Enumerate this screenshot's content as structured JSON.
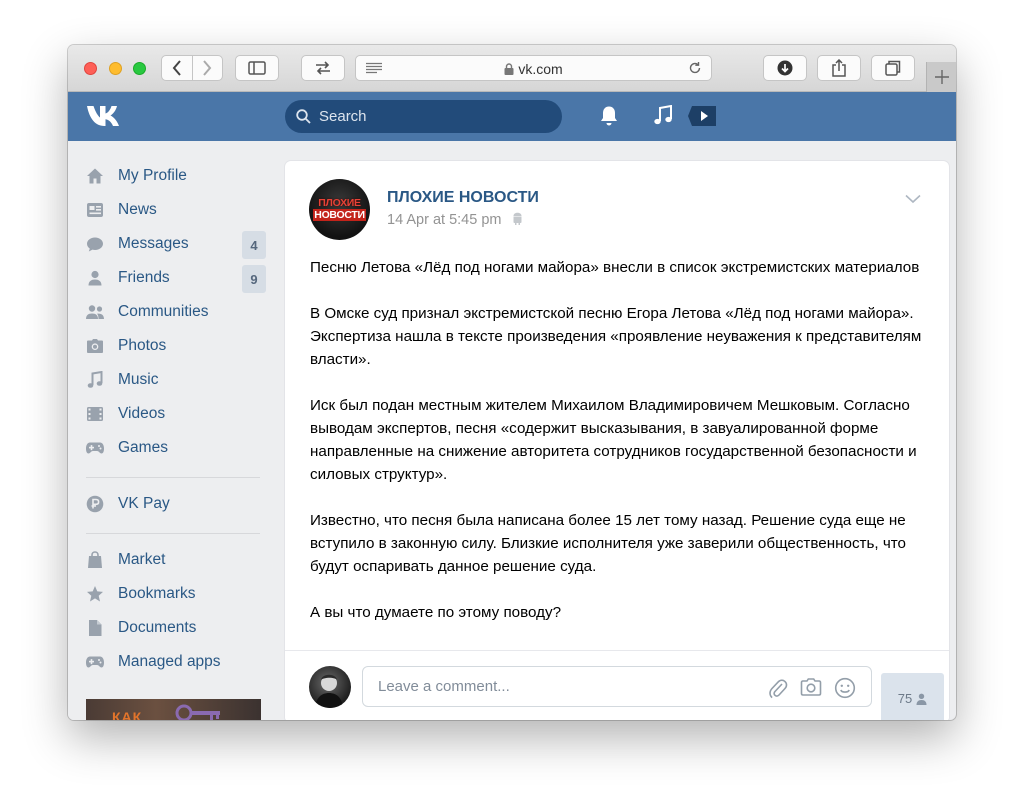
{
  "browser": {
    "url": "vk.com"
  },
  "header": {
    "search_placeholder": "Search"
  },
  "sidebar": {
    "items": [
      {
        "label": "My Profile",
        "icon": "home-icon"
      },
      {
        "label": "News",
        "icon": "newsfeed-icon"
      },
      {
        "label": "Messages",
        "icon": "messages-icon",
        "badge": "4"
      },
      {
        "label": "Friends",
        "icon": "friends-icon",
        "badge": "9"
      },
      {
        "label": "Communities",
        "icon": "communities-icon"
      },
      {
        "label": "Photos",
        "icon": "camera-icon"
      },
      {
        "label": "Music",
        "icon": "music-icon"
      },
      {
        "label": "Videos",
        "icon": "film-icon"
      },
      {
        "label": "Games",
        "icon": "gamepad-icon"
      },
      {
        "label": "VK Pay",
        "icon": "vkpay-icon"
      },
      {
        "label": "Market",
        "icon": "bag-icon"
      },
      {
        "label": "Bookmarks",
        "icon": "star-icon"
      },
      {
        "label": "Documents",
        "icon": "document-icon"
      },
      {
        "label": "Managed apps",
        "icon": "gamepad-icon"
      }
    ],
    "ad_text": "КАК"
  },
  "post": {
    "avatar_line1": "ПЛОХИЕ",
    "avatar_line2": "НОВОСТИ",
    "group_name": "ПЛОХИЕ НОВОСТИ",
    "time": "14 Apr at 5:45 pm",
    "paragraphs": [
      "Песню Летова «Лёд под ногами майора» внесли в список экстремистских материалов",
      "В Омске суд признал экстремистской песню Егора Летова «Лёд под ногами майора». Экспертиза нашла в тексте произведения «проявление неуважения к представителям власти».",
      "Иск был подан местным жителем Михаилом Владимировичем Мешковым. Согласно выводам экспертов, песня «содержит высказывания, в завуалированной форме направленные на снижение авторитета сотрудников государственной безопасности и силовых структур».",
      "Известно, что песня была написана более 15 лет тому назад. Решение суда еще не вступило в законную силу. Близкие исполнителя уже заверили общественность, что будут оспаривать данное решение суда.",
      "А вы что думаете по этому поводу?"
    ]
  },
  "comment": {
    "placeholder": "Leave a comment...",
    "viewers": "75"
  },
  "colors": {
    "vk_blue": "#4a76a8",
    "link": "#2a5885",
    "search_bg": "#224b7a"
  }
}
